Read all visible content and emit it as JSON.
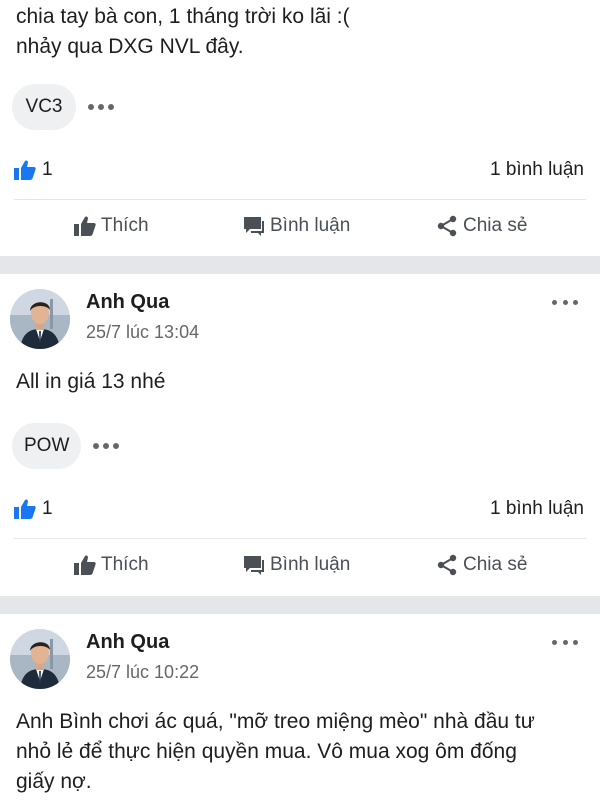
{
  "actions": {
    "like": "Thích",
    "comment": "Bình luận",
    "share": "Chia sẻ"
  },
  "posts": [
    {
      "text": "chia tay bà con, 1 tháng trời ko lãi :(\nnhảy qua DXG NVL đây.",
      "tag": "VC3",
      "likes": "1",
      "comments": "1 bình luận"
    },
    {
      "author": "Anh Qua",
      "time": "25/7 lúc 13:04",
      "text": "All in giá 13 nhé",
      "tag": "POW",
      "likes": "1",
      "comments": "1 bình luận"
    },
    {
      "author": "Anh Qua",
      "time": "25/7 lúc 10:22",
      "text": "Anh Bình chơi ác quá, \"mỡ treo miệng mèo\" nhà đầu tư nhỏ lẻ để thực hiện quyền mua. Vô mua xog ôm đống giấy nợ.\nÁc hơn thú :(("
    }
  ],
  "colors": {
    "like_blue": "#1877f2",
    "divider": "#e4e6e9",
    "secondary_text": "#65676b"
  }
}
